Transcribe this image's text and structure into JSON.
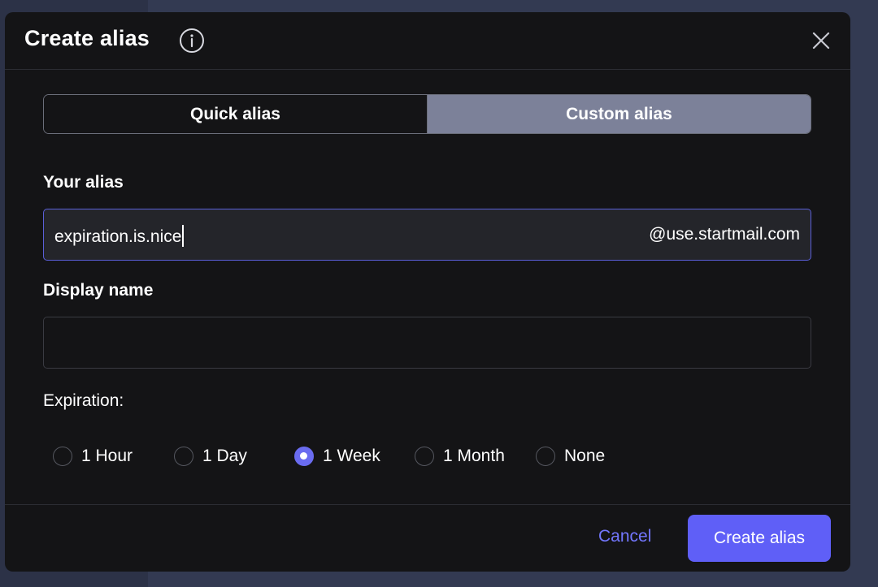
{
  "modal": {
    "title": "Create alias",
    "info_icon": "info-circle-icon",
    "close_icon": "close-x-icon"
  },
  "alias_type": {
    "options": [
      "Quick alias",
      "Custom alias"
    ],
    "selected": "Custom alias"
  },
  "alias_field": {
    "label": "Your alias",
    "value": "expiration.is.nice",
    "domain": "@use.startmail.com"
  },
  "display_name_field": {
    "label": "Display name",
    "value": ""
  },
  "expiration": {
    "label": "Expiration:",
    "options": [
      "1 Hour",
      "1 Day",
      "1 Week",
      "1 Month",
      "None"
    ],
    "selected": "1 Week"
  },
  "footer": {
    "cancel_label": "Cancel",
    "create_label": "Create alias"
  },
  "colors": {
    "modal_bg": "#141416",
    "accent": "#5f5ff7",
    "segment_selected": "#7c8199",
    "link": "#7377ff"
  }
}
